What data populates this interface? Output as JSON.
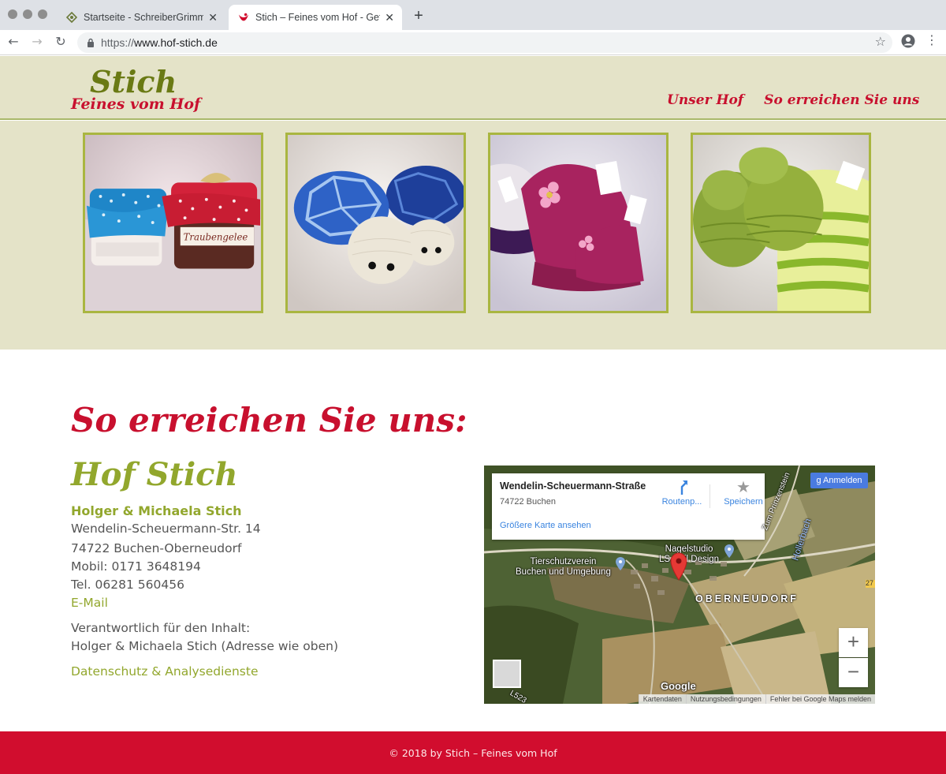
{
  "browser": {
    "tabs": [
      {
        "title": "Startseite - SchreiberGrimm . W",
        "active": false
      },
      {
        "title": "Stich – Feines vom Hof - Geflü",
        "active": true
      }
    ],
    "new_tab": "+",
    "url_scheme": "https://",
    "url_host": "www.hof-stich.de"
  },
  "site": {
    "logo_main": "Stich",
    "logo_sub": "Feines vom Hof",
    "nav": [
      "Unser Hof",
      "So erreichen Sie uns"
    ]
  },
  "gallery": [
    {
      "name": "jam-jars"
    },
    {
      "name": "crochet-turtles"
    },
    {
      "name": "knitted-hat-booties-pink"
    },
    {
      "name": "knitted-booties-green"
    }
  ],
  "jar_label": "Traubengelee",
  "content": {
    "title": "So erreichen Sie uns:",
    "farm_name": "Hof Stich",
    "owners": "Holger & Michaela Stich",
    "street": "Wendelin-Scheuermann-Str. 14",
    "city": "74722 Buchen-Oberneudorf",
    "mobile": "Mobil: 0171 3648194",
    "phone": "Tel. 06281 560456",
    "email_link": "E-Mail",
    "responsible_label": "Verantwortlich für den Inhalt:",
    "responsible_value": "Holger & Michaela Stich (Adresse wie oben)",
    "privacy_link": "Datenschutz & Analysedienste"
  },
  "map": {
    "place_title": "Wendelin-Scheuermann-Straße",
    "place_addr": "74722 Buchen",
    "bigger_map": "Größere Karte ansehen",
    "route_label": "Routenp...",
    "save_label": "Speichern",
    "signin": "Anmelden",
    "labels": {
      "shelter": "Tierschutzverein\nBuchen und Umgebung",
      "nail": "Nagelstudio\nLS Nail Design",
      "village": "OBERNEUDORF",
      "creek": "Hollerbach",
      "street": "Zum Prinzenstein",
      "road": "L523",
      "road_num": "27"
    },
    "zoom_in": "+",
    "zoom_out": "−",
    "footer": [
      "Kartendaten",
      "Nutzungsbedingungen",
      "Fehler bei Google Maps melden"
    ],
    "brand": "Google"
  },
  "footer": {
    "text": "© 2018 by Stich – Feines vom Hof"
  },
  "colors": {
    "header_bg": "#e4e3c8",
    "brand_red": "#c8102e",
    "brand_green": "#92a72d",
    "footer_bg": "#d10d2e"
  }
}
